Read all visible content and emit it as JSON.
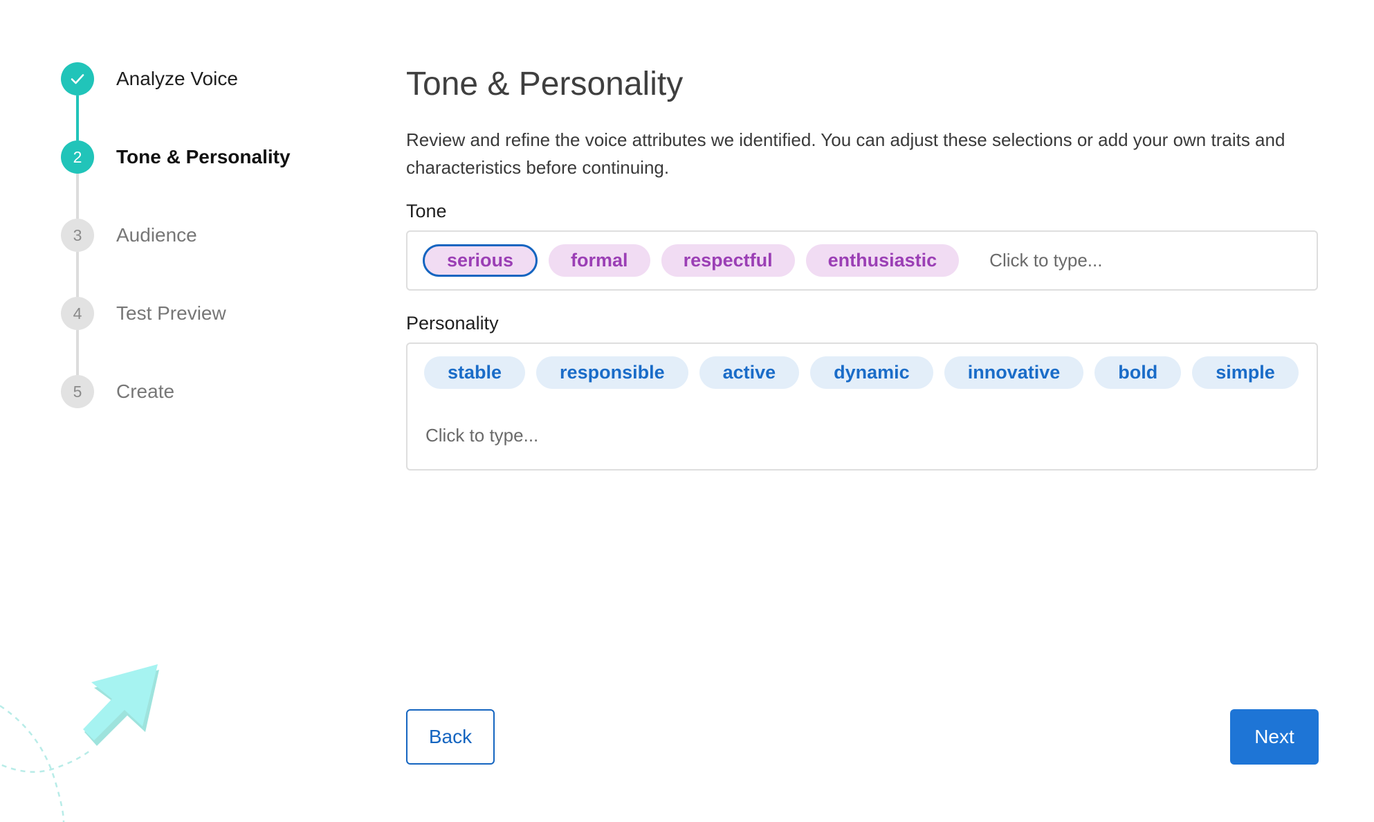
{
  "steps": [
    {
      "number": "",
      "label": "Analyze Voice",
      "state": "done",
      "icon": "check-icon"
    },
    {
      "number": "2",
      "label": "Tone & Personality",
      "state": "active"
    },
    {
      "number": "3",
      "label": "Audience",
      "state": "pending"
    },
    {
      "number": "4",
      "label": "Test Preview",
      "state": "pending"
    },
    {
      "number": "5",
      "label": "Create",
      "state": "pending"
    }
  ],
  "main": {
    "title": "Tone & Personality",
    "description": "Review and refine the voice attributes we identified. You can adjust these selections or add your own traits and characteristics before continuing.",
    "tone": {
      "label": "Tone",
      "tags": [
        "serious",
        "formal",
        "respectful",
        "enthusiastic"
      ],
      "selected": "serious",
      "placeholder": "Click to type..."
    },
    "personality": {
      "label": "Personality",
      "tags": [
        "stable",
        "responsible",
        "active",
        "dynamic",
        "innovative",
        "bold",
        "simple"
      ],
      "placeholder": "Click to type..."
    }
  },
  "buttons": {
    "back": "Back",
    "next": "Next"
  },
  "colors": {
    "accent_teal": "#21c4b9",
    "primary_blue": "#1e75d6",
    "tone_tag_bg": "#f1dcf3",
    "tone_tag_text": "#9b3fb5",
    "personality_tag_bg": "#e3eef9",
    "personality_tag_text": "#1a6cc8"
  }
}
